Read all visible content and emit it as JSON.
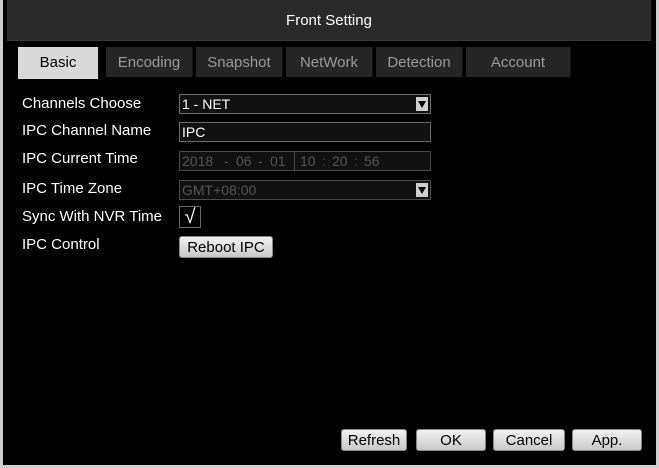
{
  "window": {
    "title": "Front Setting"
  },
  "tabs": [
    {
      "label": "Basic",
      "active": true
    },
    {
      "label": "Encoding",
      "active": false
    },
    {
      "label": "Snapshot",
      "active": false
    },
    {
      "label": "NetWork",
      "active": false
    },
    {
      "label": "Detection",
      "active": false
    },
    {
      "label": "Account",
      "active": false
    }
  ],
  "form": {
    "channels_choose": {
      "label": "Channels Choose",
      "value": "1 - NET"
    },
    "ipc_channel_name": {
      "label": "IPC Channel Name",
      "value": "IPC"
    },
    "ipc_current_time": {
      "label": "IPC Current Time",
      "year": "2018",
      "month": "06",
      "day": "01",
      "hour": "10",
      "minute": "20",
      "second": "56",
      "date_sep": "-",
      "time_sep": ":"
    },
    "ipc_time_zone": {
      "label": "IPC Time Zone",
      "value": "GMT+08:00"
    },
    "sync_with_nvr_time": {
      "label": "Sync With NVR Time",
      "checked": true,
      "mark": "√"
    },
    "ipc_control": {
      "label": "IPC Control",
      "button": "Reboot IPC"
    }
  },
  "footer": {
    "refresh": "Refresh",
    "ok": "OK",
    "cancel": "Cancel",
    "apply": "App."
  },
  "colors": {
    "background": "#000000",
    "title_bar": "#2a2a2a",
    "active_tab": "#d9d9d9",
    "inactive_tab": "#262626",
    "text": "#ffffff",
    "disabled_text": "#555555"
  }
}
